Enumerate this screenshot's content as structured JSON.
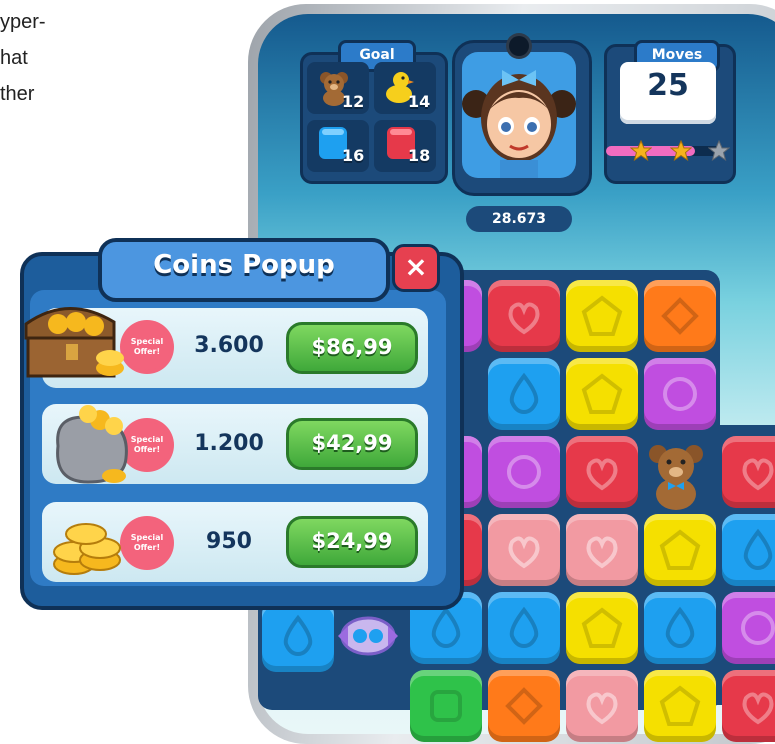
{
  "side_text": [
    "yper-",
    "hat",
    "ther"
  ],
  "goal": {
    "title": "Goal",
    "items": [
      {
        "icon": "teddy-bear-icon",
        "count": "12"
      },
      {
        "icon": "rubber-duck-icon",
        "count": "14"
      },
      {
        "icon": "blue-cube-icon",
        "count": "16"
      },
      {
        "icon": "red-cube-icon",
        "count": "18"
      }
    ]
  },
  "score": "28.673",
  "moves": {
    "title": "Moves",
    "value": "25",
    "progress": 0.75,
    "stars_earned": 2,
    "stars_total": 3
  },
  "popup": {
    "title": "Coins Popup",
    "close_label": "×",
    "offers": [
      {
        "badge": "Special Offer!",
        "amount": "3.600",
        "price": "$86,99",
        "image": "treasure-chest-icon"
      },
      {
        "badge": "Special Offer!",
        "amount": "1.200",
        "price": "$42,99",
        "image": "coin-sack-icon"
      },
      {
        "badge": "Special Offer!",
        "amount": "950",
        "price": "$24,99",
        "image": "coin-stack-icon"
      }
    ]
  },
  "colors": {
    "red": "#e6394a",
    "yellow": "#f5e000",
    "orange": "#ff7a1a",
    "purple": "#c04ee0",
    "blue": "#1ea0f0",
    "pink": "#f29aa2",
    "green": "#2fc24a",
    "popup": "#1d5d9c",
    "price_green": "#4cba3f"
  }
}
